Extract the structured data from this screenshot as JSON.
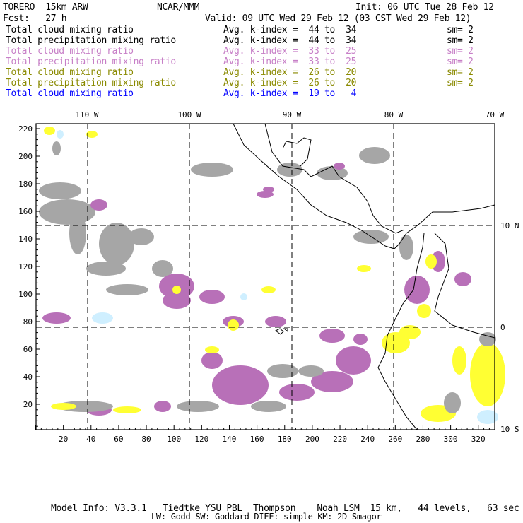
{
  "header": {
    "model": "TORERO  15km ARW",
    "org": "NCAR/MMM",
    "init": "Init: 06 UTC Tue 28 Feb 12",
    "fcst": "Fcst:   27 h",
    "valid": "Valid: 09 UTC Wed 29 Feb 12 (03 CST Wed 29 Feb 12)"
  },
  "legend": [
    {
      "field": "Total cloud mixing ratio",
      "kindex": "Avg. k-index =  44 to  34",
      "sm": "sm= 2",
      "color": "#000000"
    },
    {
      "field": "Total precipitation mixing ratio",
      "kindex": "Avg. k-index =  44 to  34",
      "sm": "sm= 2",
      "color": "#000000"
    },
    {
      "field": "Total cloud mixing ratio",
      "kindex": "Avg. k-index =  33 to  25",
      "sm": "sm= 2",
      "color": "#c77fc7"
    },
    {
      "field": "Total precipitation mixing ratio",
      "kindex": "Avg. k-index =  33 to  25",
      "sm": "sm= 2",
      "color": "#c77fc7"
    },
    {
      "field": "Total cloud mixing ratio",
      "kindex": "Avg. k-index =  26 to  20",
      "sm": "sm= 2",
      "color": "#8a8a00"
    },
    {
      "field": "Total precipitation mixing ratio",
      "kindex": "Avg. k-index =  26 to  20",
      "sm": "sm= 2",
      "color": "#8a8a00"
    },
    {
      "field": "Total cloud mixing ratio",
      "kindex": "Avg. k-index =  19 to   4",
      "sm": "",
      "color": "#0000ff"
    }
  ],
  "map": {
    "lon_labels": [
      "110 W",
      "100 W",
      "90 W",
      "80 W",
      "70 W"
    ],
    "lat_labels": [
      "10 N",
      "0",
      "10 S"
    ],
    "x_ticks": [
      "20",
      "40",
      "60",
      "80",
      "100",
      "120",
      "140",
      "160",
      "180",
      "200",
      "220",
      "240",
      "260",
      "280",
      "300",
      "320"
    ],
    "y_ticks": [
      "20",
      "40",
      "60",
      "80",
      "100",
      "120",
      "140",
      "160",
      "180",
      "200",
      "220"
    ]
  },
  "footer": {
    "line1": "Model Info: V3.3.1   Tiedtke YSU PBL  Thompson    Noah LSM  15 km,   44 levels,   63 sec",
    "line2": "LW: Godd SW: Goddard DIFF: simple KM: 2D Smagor"
  }
}
